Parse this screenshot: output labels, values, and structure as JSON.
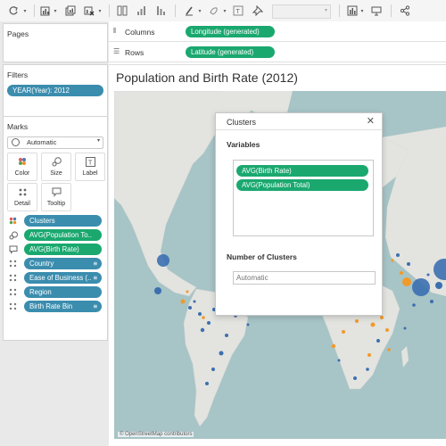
{
  "colors": {
    "accent_green": "#1aa86f",
    "accent_teal": "#3b8dae",
    "water": "#a7c4c6",
    "land": "#e3e3df",
    "point_blue": "#3b6fb0",
    "point_orange": "#f19a2a"
  },
  "toolbar": {
    "icons": [
      "redo-icon",
      "new-worksheet-icon",
      "duplicate-sheet-icon",
      "clear-sheet-icon",
      "swap-axes-icon",
      "sort-ascending-icon",
      "sort-descending-icon",
      "highlight-icon",
      "group-icon",
      "label-icon",
      "pin-icon",
      "show-me-icon",
      "presentation-icon",
      "share-icon"
    ]
  },
  "left_panel": {
    "pages_title": "Pages",
    "filters_title": "Filters",
    "filters": [
      "YEAR(Year): 2012"
    ],
    "marks_title": "Marks",
    "mark_type": "Automatic",
    "mark_buttons": [
      "Color",
      "Size",
      "Label",
      "Detail",
      "Tooltip"
    ],
    "mark_fields": [
      {
        "icon": "color-dots-icon",
        "label": "Clusters",
        "type": "teal"
      },
      {
        "icon": "size-icon",
        "label": "AVG(Population To..",
        "type": "green"
      },
      {
        "icon": "tooltip-icon",
        "label": "AVG(Birth Rate)",
        "type": "green"
      },
      {
        "icon": "detail-dots-icon",
        "label": "Country",
        "type": "blue"
      },
      {
        "icon": "detail-dots-icon",
        "label": "Ease of Business (..",
        "type": "blue"
      },
      {
        "icon": "detail-dots-icon",
        "label": "Region",
        "type": "blue"
      },
      {
        "icon": "detail-dots-icon",
        "label": "Birth Rate Bin",
        "type": "blue"
      }
    ]
  },
  "shelves": {
    "columns_label": "Columns",
    "columns_pill": "Longitude (generated)",
    "rows_label": "Rows",
    "rows_pill": "Latitude (generated)"
  },
  "view": {
    "title": "Population and Birth Rate (2012)",
    "attribution": "© OpenStreetMap contributors"
  },
  "dialog": {
    "title": "Clusters",
    "variables_label": "Variables",
    "variables": [
      "AVG(Birth Rate)",
      "AVG(Population Total)"
    ],
    "clusters_label": "Number of Clusters",
    "clusters_placeholder": "Automatic"
  }
}
